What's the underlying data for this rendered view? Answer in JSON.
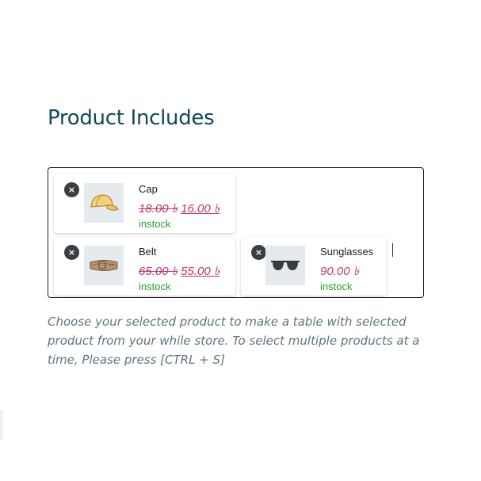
{
  "title": "Product Includes",
  "products": [
    {
      "name": "Cap",
      "old_price": "18.00 ৳",
      "new_price": "16.00 ৳",
      "stock": "instock",
      "icon": "cap-image",
      "remove_symbol": "×"
    },
    {
      "name": "Belt",
      "old_price": "65.00 ৳",
      "new_price": "55.00 ৳",
      "stock": "instock",
      "icon": "belt-image",
      "remove_symbol": "×"
    },
    {
      "name": "Sunglasses",
      "old_price": "",
      "new_price": "90.00 ৳",
      "stock": "instock",
      "icon": "sunglasses-image",
      "remove_symbol": "×"
    }
  ],
  "help_text": "Choose your selected product to make a table with selected product from your while store. To select multiple products at a time, Please press [CTRL + S]",
  "colors": {
    "title": "#0e4a57",
    "price": "#c4336b",
    "stock": "#23a32b",
    "help": "#5e7581",
    "remove_bg": "#3a3f44"
  }
}
